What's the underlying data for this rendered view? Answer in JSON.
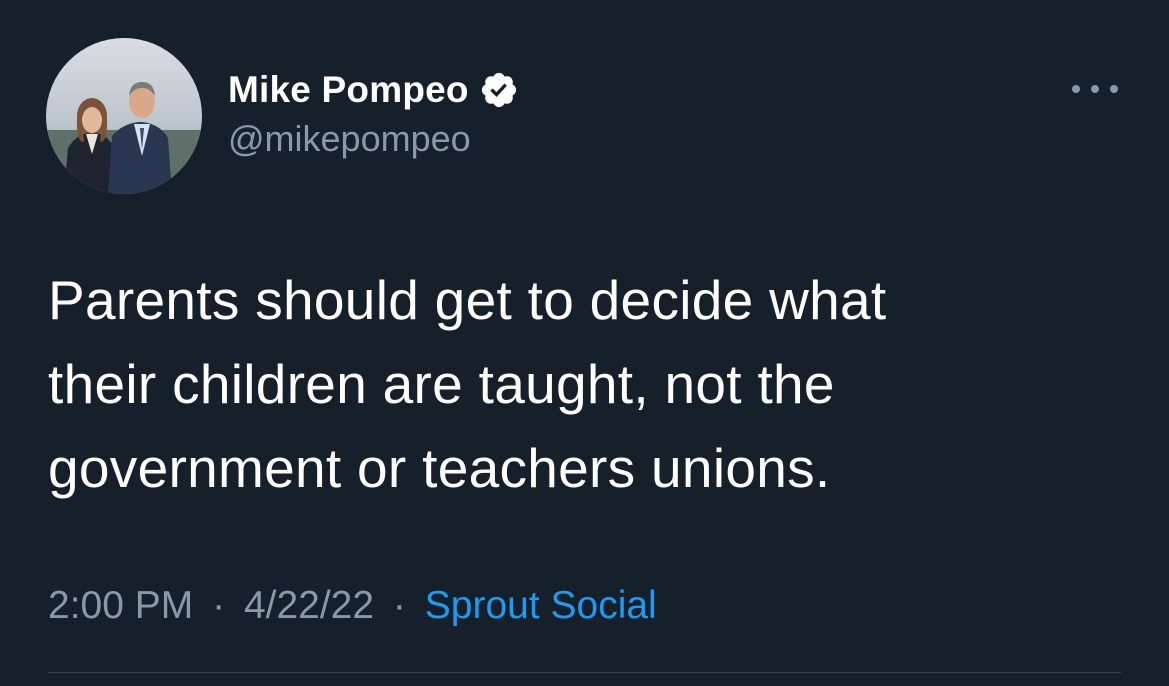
{
  "tweet": {
    "author": {
      "display_name": "Mike Pompeo",
      "handle": "@mikepompeo",
      "verified": true
    },
    "text_lines": [
      "Parents should get to decide what",
      "their children are taught, not the",
      "government or teachers unions."
    ],
    "meta": {
      "time": "2:00 PM",
      "separator": "·",
      "date": "4/22/22",
      "source": "Sprout Social"
    }
  },
  "colors": {
    "background": "#15202b",
    "text_primary": "#ffffff",
    "text_secondary": "#8b98a5",
    "link": "#1d9bf0",
    "divider": "#38444d"
  },
  "icons": {
    "verified": "verified-badge-icon",
    "more": "more-options-icon"
  }
}
